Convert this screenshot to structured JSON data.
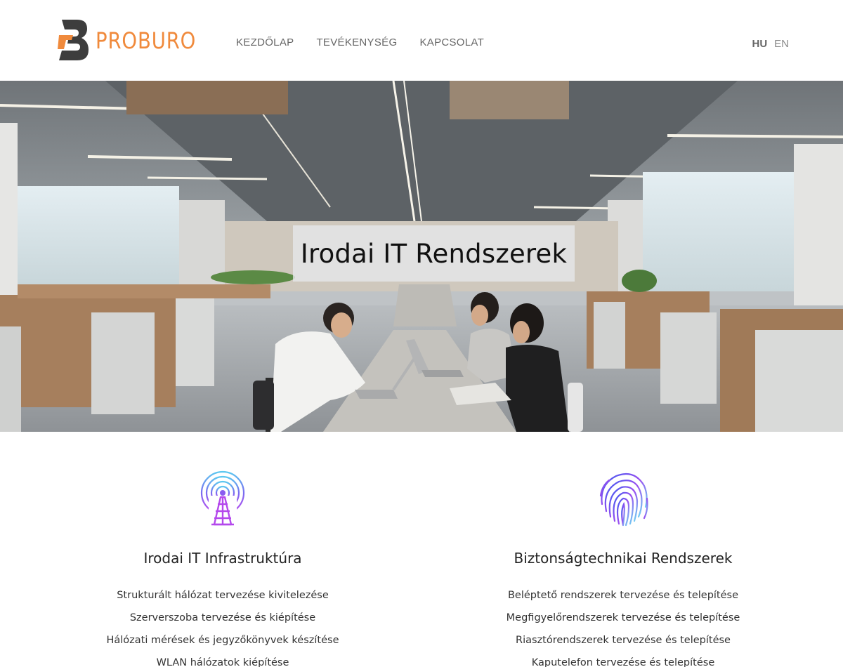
{
  "brand": {
    "name": "PROBURO",
    "accent": "#f08a3c",
    "mark_color": "#3d3d3d"
  },
  "nav": {
    "items": [
      {
        "label": "KEZDŐLAP"
      },
      {
        "label": "TEVÉKENYSÉG"
      },
      {
        "label": "KAPCSOLAT"
      }
    ]
  },
  "language": {
    "active": "HU",
    "other": "EN"
  },
  "hero": {
    "title": "Irodai IT Rendszerek"
  },
  "services": [
    {
      "icon": "radio-tower-icon",
      "title": "Irodai IT Infrastruktúra",
      "items": [
        "Strukturált hálózat tervezése kivitelezése",
        "Szerverszoba tervezése és kiépítése",
        "Hálózati mérések és jegyzőkönyvek készítése",
        "WLAN hálózatok kiépítése"
      ]
    },
    {
      "icon": "fingerprint-icon",
      "title": "Biztonságtechnikai Rendszerek",
      "items": [
        "Beléptető rendszerek tervezése és telepítése",
        "Megfigyelőrendszerek tervezése és telepítése",
        "Riasztórendszerek tervezése és telepítése",
        "Kaputelefon tervezése és telepítése"
      ]
    }
  ]
}
